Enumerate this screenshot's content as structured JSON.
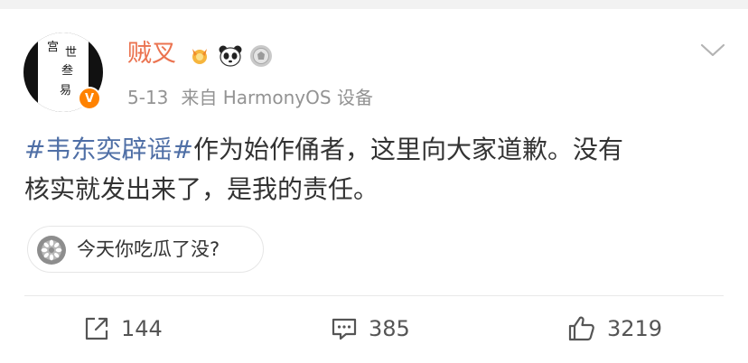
{
  "post": {
    "author": {
      "username": "贼叉",
      "avatar_text": [
        "宫",
        "世",
        "叁",
        "易"
      ],
      "verified_badge": "V",
      "badges": [
        "golden-flower-badge-icon",
        "panda-badge-icon",
        "silver-medal-badge-icon"
      ]
    },
    "meta": {
      "date": "5-13",
      "source": "来自 HarmonyOS 设备"
    },
    "content": {
      "hashtag": "#韦东奕辟谣#",
      "text_line1": "作为始作俑者，这里向大家道歉。没有",
      "text_line2": "核实就发出来了，是我的责任。"
    },
    "topic_chip": {
      "label": "今天你吃瓜了没?",
      "icon": "melon-slice-icon"
    },
    "actions": {
      "repost_count": "144",
      "comment_count": "385",
      "like_count": "3219"
    }
  },
  "colors": {
    "username": "#eb7350",
    "hashtag": "#4f6fa6",
    "meta": "#939393",
    "verified": "#ff8200"
  }
}
